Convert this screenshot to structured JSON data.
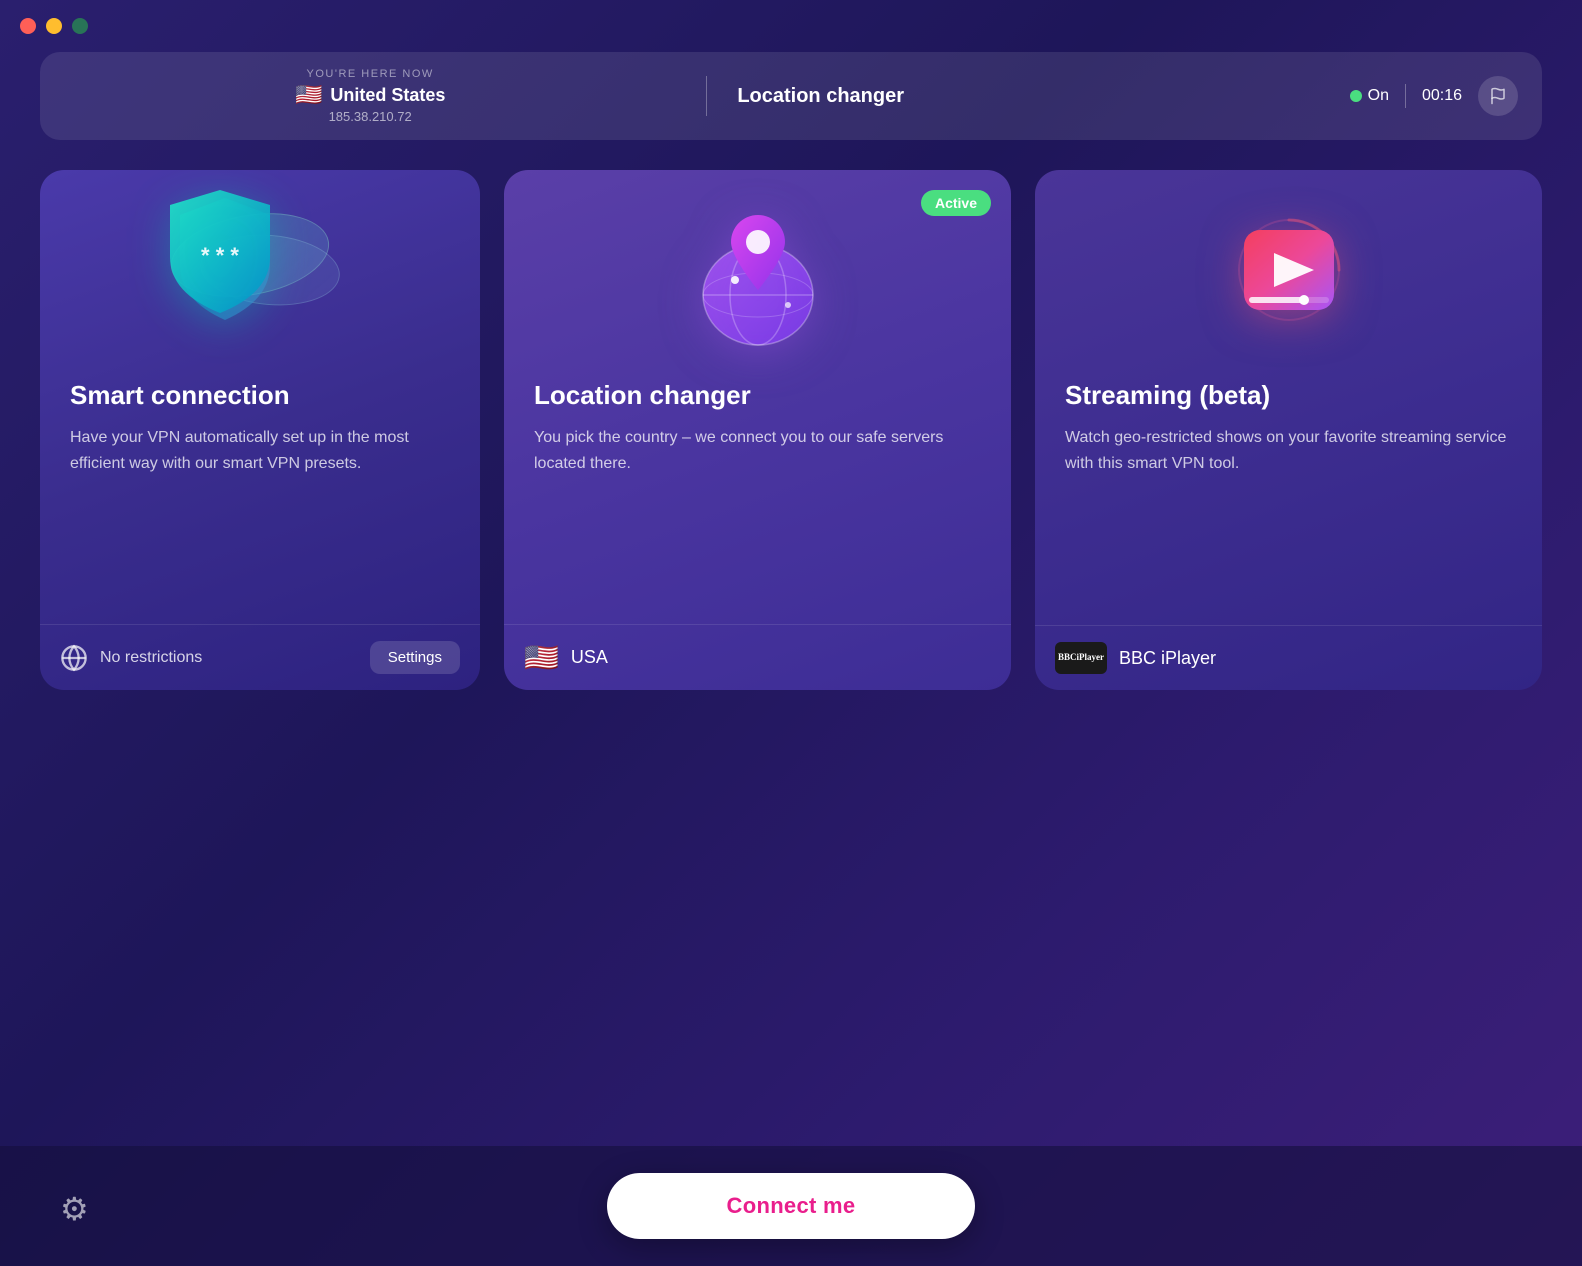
{
  "titlebar": {
    "close": "close",
    "minimize": "minimize",
    "maximize": "maximize"
  },
  "statusbar": {
    "label": "YOU'RE HERE NOW",
    "country": "United States",
    "flag": "🇺🇸",
    "ip": "185.38.210.72",
    "feature": "Location changer",
    "status": "On",
    "timer": "00:16"
  },
  "cards": {
    "smart": {
      "title": "Smart connection",
      "description": "Have your VPN automatically set up in the most efficient way with our smart VPN presets.",
      "footer_label": "No restrictions",
      "footer_button": "Settings"
    },
    "location": {
      "badge": "Active",
      "title": "Location changer",
      "description": "You pick the country – we connect you to our safe servers located there.",
      "country_flag": "🇺🇸",
      "country_name": "USA"
    },
    "streaming": {
      "title": "Streaming (beta)",
      "description": "Watch geo-restricted shows on your favorite streaming service with this smart VPN tool.",
      "service_name": "BBC iPlayer",
      "service_logo_line1": "BBC",
      "service_logo_line2": "iPlayer"
    }
  },
  "bottom": {
    "connect_button": "Connect me",
    "settings_icon": "⚙"
  }
}
